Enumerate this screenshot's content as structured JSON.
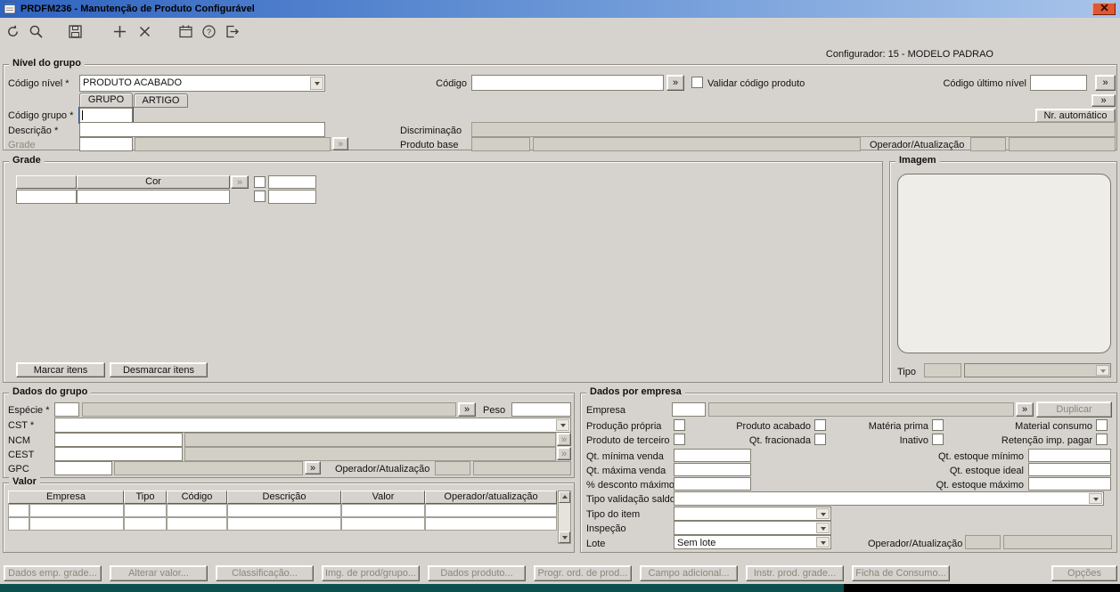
{
  "window": {
    "title": "PRDFM236 - Manutenção de Produto Configurável",
    "configurator": "Configurador: 15 - MODELO PADRAO"
  },
  "misc": {
    "more": "»"
  },
  "nivel": {
    "title": "Nível do grupo",
    "codigo_nivel_label": "Código nível *",
    "codigo_nivel_value": "PRODUTO ACABADO",
    "tab_grupo": "GRUPO",
    "tab_artigo": "ARTIGO",
    "codigo_label": "Código",
    "codigo_value": "",
    "validar_label": "Validar código produto",
    "codigo_ultimo_label": "Código último nível",
    "codigo_ultimo_value": "",
    "nr_automatico_label": "Nr. automático",
    "codigo_grupo_label": "Código grupo *",
    "codigo_grupo_value": "",
    "descricao_label": "Descrição *",
    "descricao_value": "",
    "discriminacao_label": "Discriminação",
    "grade_label": "Grade",
    "produto_base_label": "Produto base",
    "operador_label": "Operador/Atualização"
  },
  "grade": {
    "title": "Grade",
    "cor_header": "Cor",
    "marcar_label": "Marcar itens",
    "desmarcar_label": "Desmarcar itens"
  },
  "imagem": {
    "title": "Imagem",
    "tipo_label": "Tipo"
  },
  "dados_grupo": {
    "title": "Dados do grupo",
    "especie_label": "Espécie *",
    "peso_label": "Peso",
    "cst_label": "CST *",
    "ncm_label": "NCM",
    "cest_label": "CEST",
    "gpc_label": "GPC",
    "operador_label": "Operador/Atualização"
  },
  "valor": {
    "title": "Valor",
    "headers": [
      "Empresa",
      "Tipo",
      "Código",
      "Descrição",
      "Valor",
      "Operador/atualização"
    ]
  },
  "empresa": {
    "title": "Dados por empresa",
    "empresa_label": "Empresa",
    "duplicar_label": "Duplicar",
    "check_producao": "Produção própria",
    "check_acabado": "Produto acabado",
    "check_materia": "Matéria prima",
    "check_consumo": "Material consumo",
    "check_terceiro": "Produto de terceiro",
    "check_fracionada": "Qt. fracionada",
    "check_inativo": "Inativo",
    "check_retencao": "Retenção imp. pagar",
    "qt_minima_label": "Qt. mínima venda",
    "qt_maxima_label": "Qt. máxima venda",
    "desconto_label": "% desconto máximo",
    "tipo_validacao_label": "Tipo validação saldo",
    "tipo_item_label": "Tipo do item",
    "inspecao_label": "Inspeção",
    "lote_label": "Lote",
    "lote_value": "Sem lote",
    "operador_label": "Operador/Atualização",
    "estoque_minimo_label": "Qt. estoque mínimo",
    "estoque_ideal_label": "Qt. estoque ideal",
    "estoque_maximo_label": "Qt. estoque máximo"
  },
  "bottom": {
    "buttons": [
      "Dados emp. grade...",
      "Alterar valor...",
      "Classificação...",
      "Img. de prod/grupo...",
      "Dados produto...",
      "Progr. ord. de prod...",
      "Campo adicional...",
      "Instr. prod. grade...",
      "Ficha de Consumo..."
    ],
    "opcoes_label": "Opções"
  }
}
